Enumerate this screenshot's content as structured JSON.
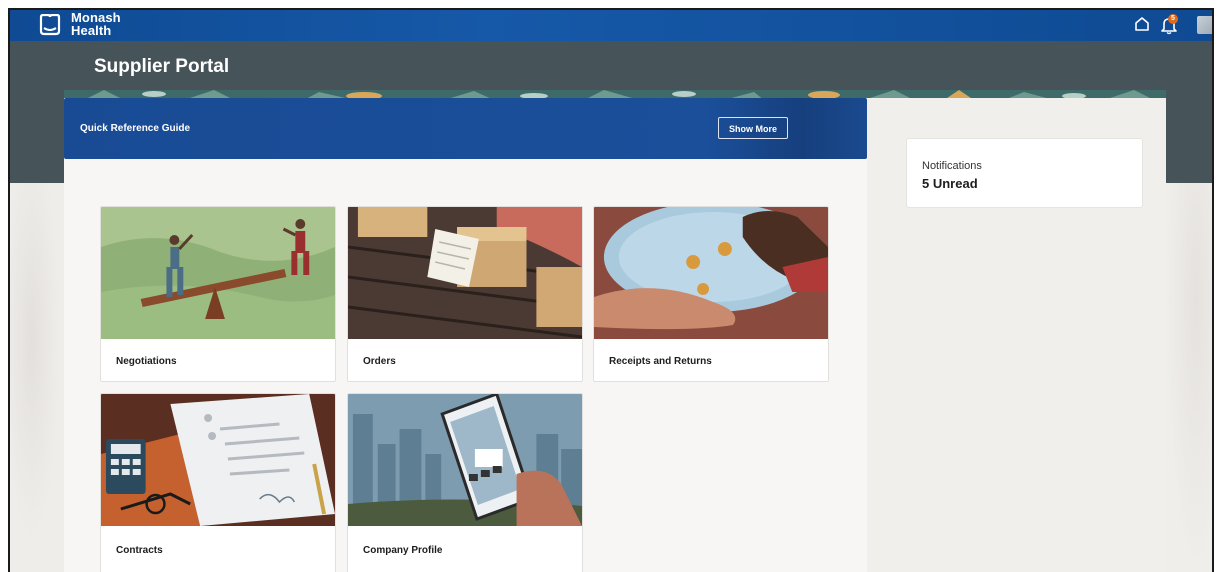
{
  "header": {
    "logo_line1": "Monash",
    "logo_line2": "Health",
    "notification_count": "5",
    "icons": [
      "logo-icon",
      "home-icon",
      "bell-icon",
      "avatar"
    ]
  },
  "page": {
    "title": "Supplier Portal"
  },
  "quick_reference": {
    "title": "Quick Reference Guide",
    "button_label": "Show More"
  },
  "tiles": [
    {
      "label": "Negotiations"
    },
    {
      "label": "Orders"
    },
    {
      "label": "Receipts and Returns"
    },
    {
      "label": "Contracts"
    },
    {
      "label": "Company Profile"
    }
  ],
  "notifications": {
    "label": "Notifications",
    "count_text": "5 Unread"
  },
  "colors": {
    "topbar": "#0f4a93",
    "hero": "#465459",
    "banner": "#194b95",
    "badge": "#e06a1d"
  }
}
